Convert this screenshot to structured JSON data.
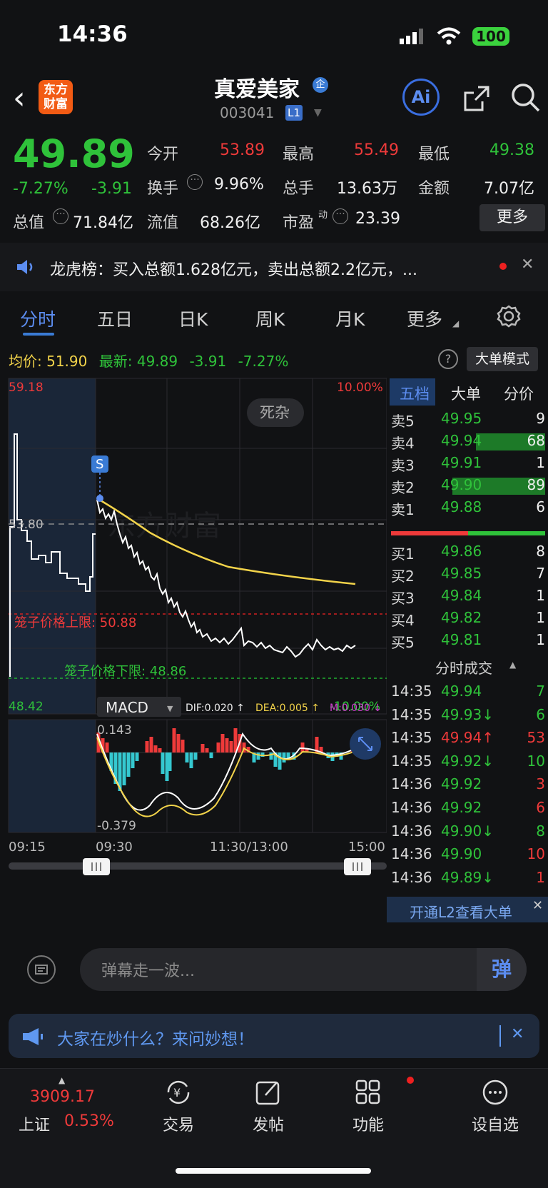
{
  "status": {
    "time": "14:36",
    "battery": "100"
  },
  "header": {
    "logo_line1": "东方",
    "logo_line2": "财富",
    "name": "真爱美家",
    "name_badge": "企",
    "code": "003041",
    "level": "L1",
    "ai_label": "Ai"
  },
  "quote": {
    "price": "49.89",
    "pct": "-7.27%",
    "change": "-3.91",
    "open_label": "今开",
    "open": "53.89",
    "high_label": "最高",
    "high": "55.49",
    "low_label": "最低",
    "low": "49.38",
    "turnover_label": "换手",
    "turnover": "9.96%",
    "volume_label": "总手",
    "volume": "13.63万",
    "amount_label": "金额",
    "amount": "7.07亿",
    "mktcap_label": "总值",
    "mktcap": "71.84亿",
    "float_label": "流值",
    "float": "68.26亿",
    "pe_label": "市盈",
    "pe_sup": "动",
    "pe": "23.39",
    "more_label": "更多"
  },
  "notice": {
    "text": "龙虎榜：买入总额1.628亿元，卖出总额2.2亿元，..."
  },
  "tabs": [
    {
      "label": "分时",
      "active": true
    },
    {
      "label": "五日"
    },
    {
      "label": "日K"
    },
    {
      "label": "周K"
    },
    {
      "label": "月K"
    },
    {
      "label": "更多"
    }
  ],
  "infoline": {
    "avg_label": "均价:",
    "avg": "51.90",
    "latest_label": "最新:",
    "latest": "49.89",
    "chg": "-3.91",
    "pct": "-7.27%",
    "mode_button": "大单模式"
  },
  "chart": {
    "y_top_left": "59.18",
    "y_top_right": "10.00%",
    "y_mid": "53.80",
    "y_bot_left": "48.42",
    "y_bot_right": "-10.00%",
    "tag_label": "死杂",
    "marker": "S",
    "watermark": "东方财富",
    "upper_limit_label": "笼子价格上限: 50.88",
    "lower_limit_label": "笼子价格下限: 48.86",
    "indicator": "MACD",
    "dif": "DIF:0.020 ↑",
    "dea": "DEA:0.005 ↑",
    "m": "M:0.030 ↓",
    "macd_top": "0.143",
    "macd_bot": "-0.379",
    "x_labels": [
      "09:15",
      "09:30",
      "11:30/13:00",
      "15:00"
    ],
    "colors": {
      "price": "#ffffff",
      "avg": "#f2d34a",
      "up": "#ee3a3a",
      "down": "#35c8d0"
    }
  },
  "chart_data": {
    "type": "line",
    "series": [
      {
        "name": "price",
        "values": [
          53.9,
          53.5,
          53.0,
          52.4,
          51.6,
          51.0,
          50.4,
          50.3,
          50.1,
          50.0,
          50.2,
          49.95,
          49.9,
          50.0,
          49.89
        ]
      },
      {
        "name": "avg",
        "values": [
          53.9,
          53.4,
          53.0,
          52.7,
          52.5,
          52.3,
          52.2,
          52.1,
          52.05,
          52.0,
          51.98,
          51.95,
          51.93,
          51.92,
          51.9
        ]
      }
    ],
    "ylim": [
      48.42,
      59.18
    ]
  },
  "book": {
    "tabs": [
      "五档",
      "大单",
      "分价"
    ],
    "asks": [
      {
        "label": "卖5",
        "price": "49.95",
        "vol": "9",
        "bar": 0.0
      },
      {
        "label": "卖4",
        "price": "49.94",
        "vol": "68",
        "bar": 0.45
      },
      {
        "label": "卖3",
        "price": "49.91",
        "vol": "1",
        "bar": 0.0
      },
      {
        "label": "卖2",
        "price": "49.90",
        "vol": "89",
        "bar": 0.6
      },
      {
        "label": "卖1",
        "price": "49.88",
        "vol": "6",
        "bar": 0.0
      }
    ],
    "bids": [
      {
        "label": "买1",
        "price": "49.86",
        "vol": "8"
      },
      {
        "label": "买2",
        "price": "49.85",
        "vol": "7"
      },
      {
        "label": "买3",
        "price": "49.84",
        "vol": "1"
      },
      {
        "label": "买4",
        "price": "49.82",
        "vol": "1"
      },
      {
        "label": "买5",
        "price": "49.81",
        "vol": "1"
      }
    ],
    "trades_title": "分时成交",
    "trades": [
      {
        "time": "14:35",
        "price": "49.94",
        "vol": "7",
        "dir": "",
        "vc": "g"
      },
      {
        "time": "14:35",
        "price": "49.93↓",
        "vol": "6",
        "dir": "",
        "vc": "g"
      },
      {
        "time": "14:35",
        "price": "49.94↑",
        "vol": "53",
        "dir": "up",
        "vc": "r"
      },
      {
        "time": "14:35",
        "price": "49.92↓",
        "vol": "10",
        "dir": "",
        "vc": "g"
      },
      {
        "time": "14:36",
        "price": "49.92",
        "vol": "3",
        "dir": "",
        "vc": "r"
      },
      {
        "time": "14:36",
        "price": "49.92",
        "vol": "6",
        "dir": "",
        "vc": "r"
      },
      {
        "time": "14:36",
        "price": "49.90↓",
        "vol": "8",
        "dir": "",
        "vc": "g"
      },
      {
        "time": "14:36",
        "price": "49.90",
        "vol": "10",
        "dir": "",
        "vc": "r"
      },
      {
        "time": "14:36",
        "price": "49.89↓",
        "vol": "1",
        "dir": "",
        "vc": "r"
      }
    ],
    "l2_banner": "开通L2查看大单"
  },
  "danmu": {
    "placeholder": "弹幕走一波...",
    "button": "弹"
  },
  "ask": {
    "text": "大家在炒什么？来问妙想！"
  },
  "bottomnav": {
    "index_value": "3909.17",
    "index_name": "上证",
    "index_pct": "0.53%",
    "items": [
      "交易",
      "发帖",
      "功能",
      "设自选"
    ]
  }
}
